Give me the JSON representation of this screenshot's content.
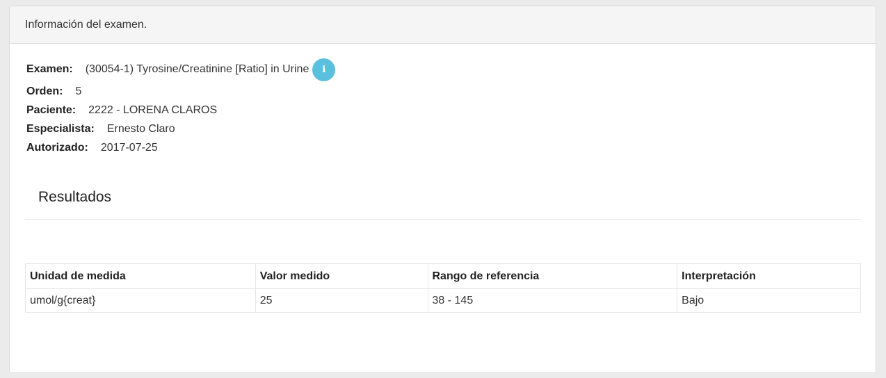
{
  "panel": {
    "title": "Información del examen."
  },
  "exam": {
    "examen_label": "Examen:",
    "examen_value": "(30054-1) Tyrosine/Creatinine [Ratio] in Urine",
    "info_icon": "info-icon",
    "orden_label": "Orden:",
    "orden_value": "5",
    "paciente_label": "Paciente:",
    "paciente_value": "2222 - LORENA CLAROS",
    "especialista_label": "Especialista:",
    "especialista_value": "Ernesto Claro",
    "autorizado_label": "Autorizado:",
    "autorizado_value": "2017-07-25"
  },
  "results": {
    "title": "Resultados",
    "headers": [
      "Unidad de medida",
      "Valor medido",
      "Rango de referencia",
      "Interpretación"
    ],
    "rows": [
      [
        "umol/g{creat}",
        "25",
        "38 - 145",
        "Bajo"
      ]
    ]
  },
  "colors": {
    "info_icon_bg": "#5bc0de",
    "header_bg": "#f5f5f6"
  }
}
